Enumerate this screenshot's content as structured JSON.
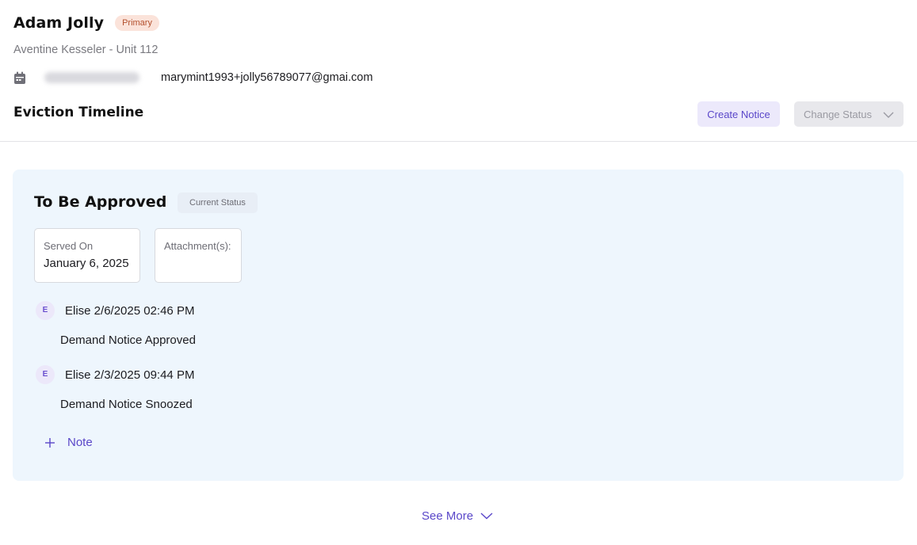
{
  "tenant": {
    "name": "Adam Jolly",
    "badge": "Primary",
    "property": "Aventine Kesseler - Unit 112",
    "email": "marymint1993+jolly56789077@gmai.com"
  },
  "section": {
    "title": "Eviction Timeline",
    "create_label": "Create Notice",
    "change_status_label": "Change Status"
  },
  "status_card": {
    "title": "To Be Approved",
    "badge": "Current Status",
    "served_label": "Served On",
    "served_value": "January 6, 2025",
    "attachments_label": "Attachment(s):",
    "entries": [
      {
        "initial": "E",
        "meta": "Elise 2/6/2025 02:46 PM",
        "text": "Demand Notice Approved"
      },
      {
        "initial": "E",
        "meta": "Elise 2/3/2025 09:44 PM",
        "text": "Demand Notice Snoozed"
      }
    ],
    "note_label": "Note"
  },
  "footer": {
    "see_more_label": "See More"
  },
  "colors": {
    "accent": "#5a47c9",
    "card_bg": "#eef6fd",
    "primary_badge_bg": "#fbe3da"
  },
  "icons": {
    "contact": "calendar-icon",
    "add": "plus-icon",
    "expand": "chevron-down-icon"
  }
}
